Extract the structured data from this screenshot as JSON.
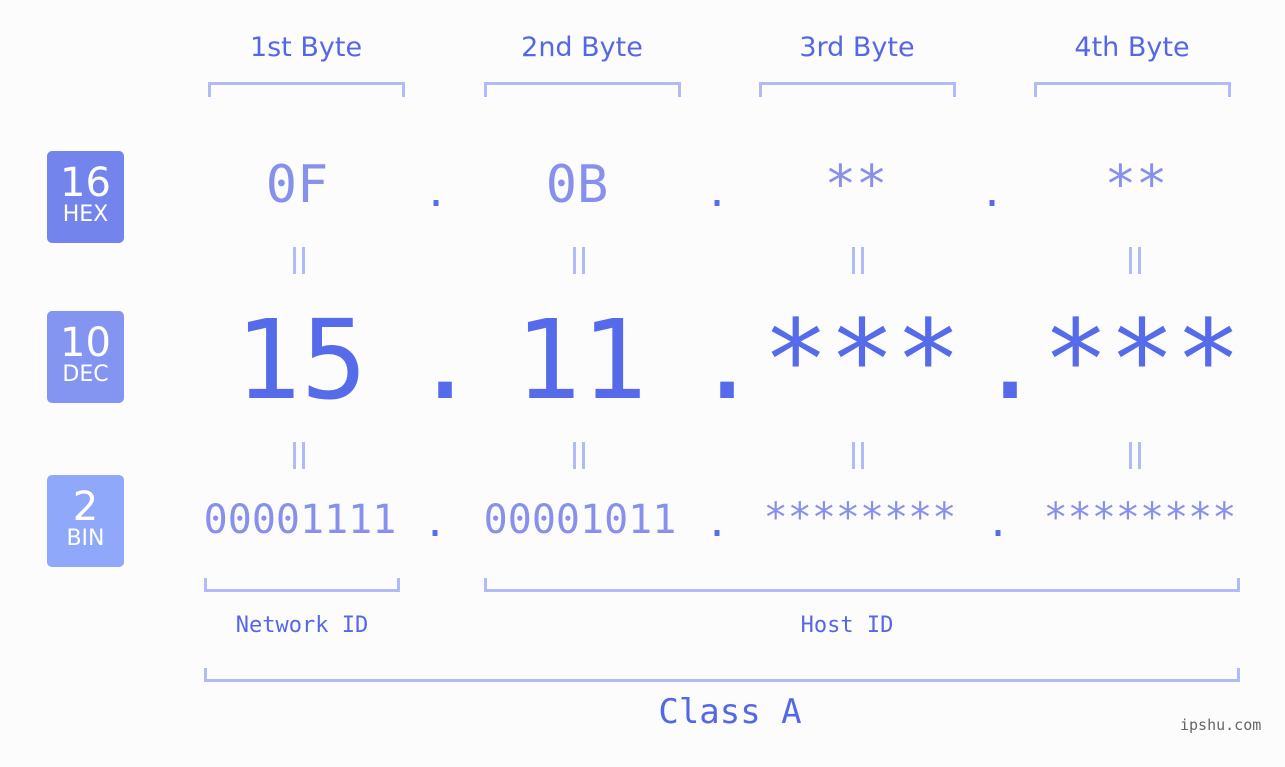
{
  "bytes": {
    "headers": [
      "1st Byte",
      "2nd Byte",
      "3rd Byte",
      "4th Byte"
    ]
  },
  "bases": {
    "hex": {
      "num": "16",
      "label": "HEX",
      "color": "#7385ec"
    },
    "dec": {
      "num": "10",
      "label": "DEC",
      "color": "#8494f1"
    },
    "bin": {
      "num": "2",
      "label": "BIN",
      "color": "#90a8f9"
    }
  },
  "values": {
    "hex": [
      "0F",
      "0B",
      "**",
      "**"
    ],
    "dec": [
      "15",
      "11",
      "***",
      "***"
    ],
    "bin": [
      "00001111",
      "00001011",
      "********",
      "********"
    ],
    "separator": "."
  },
  "segments": {
    "network_id": "Network ID",
    "host_id": "Host ID",
    "class": "Class A"
  },
  "watermark": "ipshu.com",
  "colors": {
    "accent": "#566bea",
    "light_value": "#8791ec",
    "bracket": "#b0bbf7",
    "background": "#fbfcfb"
  }
}
